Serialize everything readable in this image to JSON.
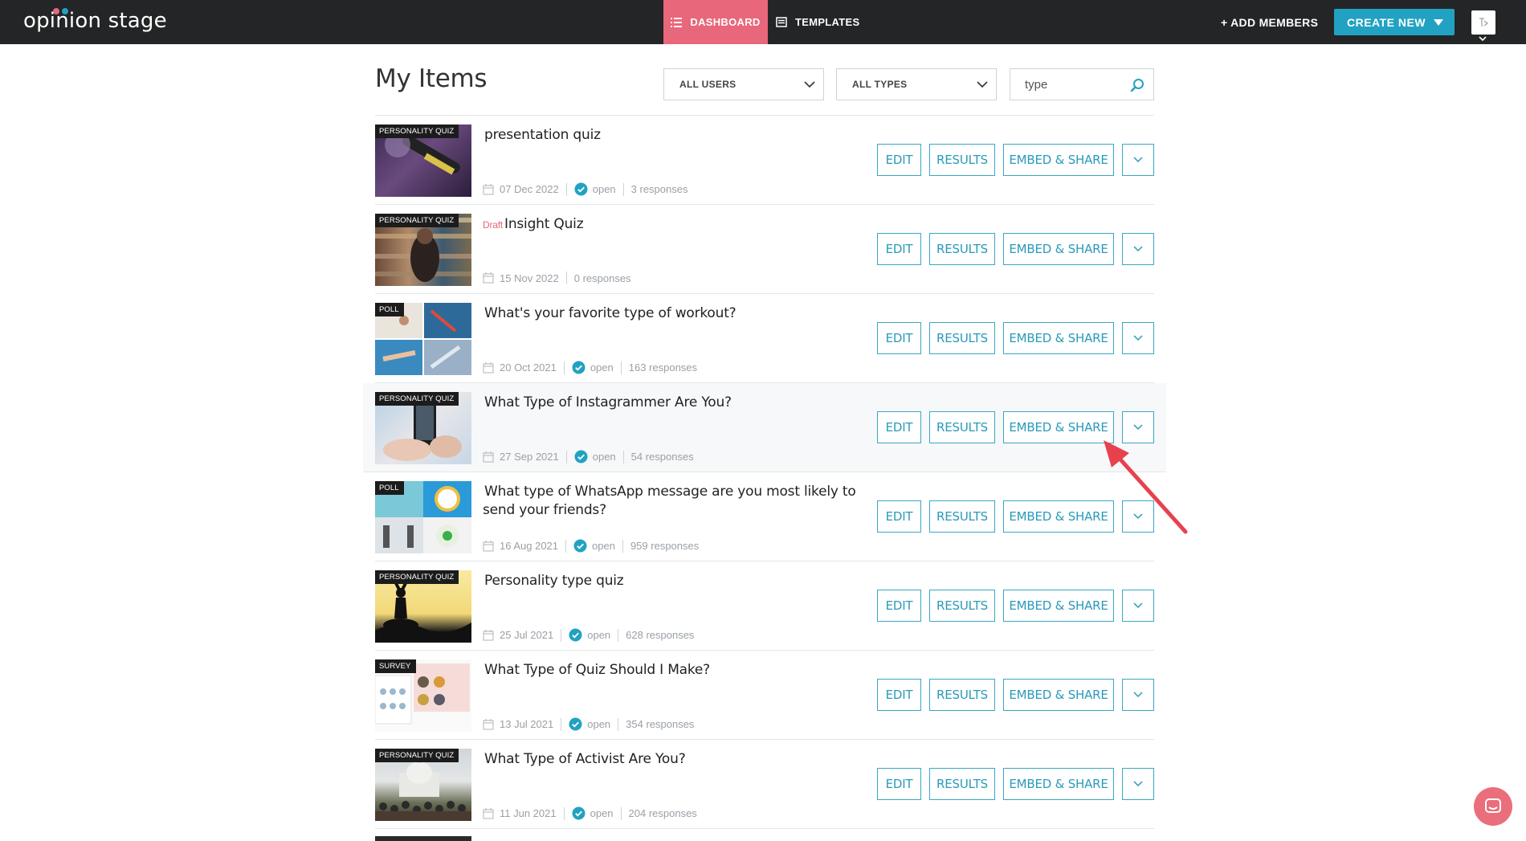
{
  "brand": {
    "logo_text": "opinion stage"
  },
  "nav": {
    "dashboard_label": "DASHBOARD",
    "templates_label": "TEMPLATES",
    "add_members_label": "+ ADD MEMBERS",
    "create_new_label": "CREATE NEW"
  },
  "header": {
    "title": "My Items",
    "users_filter": "ALL USERS",
    "types_filter": "ALL TYPES",
    "search_value": "type"
  },
  "buttons": {
    "edit": "EDIT",
    "results": "RESULTS",
    "embed_share": "EMBED & SHARE"
  },
  "items": [
    {
      "tag": "PERSONALITY QUIZ",
      "draft": "",
      "title": "presentation quiz",
      "date": "07 Dec 2022",
      "status": "open",
      "responses": "3 responses"
    },
    {
      "tag": "PERSONALITY QUIZ",
      "draft": "Draft",
      "title": "Insight Quiz",
      "date": "15 Nov 2022",
      "status": "",
      "responses": "0 responses"
    },
    {
      "tag": "POLL",
      "draft": "",
      "title": "What's your favorite type of workout?",
      "date": "20 Oct 2021",
      "status": "open",
      "responses": "163 responses"
    },
    {
      "tag": "PERSONALITY QUIZ",
      "draft": "",
      "title": "What Type of Instagrammer Are You?",
      "date": "27 Sep 2021",
      "status": "open",
      "responses": "54 responses"
    },
    {
      "tag": "POLL",
      "draft": "",
      "title": "What type of WhatsApp message are you most likely to send your friends?",
      "date": "16 Aug 2021",
      "status": "open",
      "responses": "959 responses"
    },
    {
      "tag": "PERSONALITY QUIZ",
      "draft": "",
      "title": "Personality type quiz",
      "date": "25 Jul 2021",
      "status": "open",
      "responses": "628 responses"
    },
    {
      "tag": "SURVEY",
      "draft": "",
      "title": "What Type of Quiz Should I Make?",
      "date": "13 Jul 2021",
      "status": "open",
      "responses": "354 responses"
    },
    {
      "tag": "PERSONALITY QUIZ",
      "draft": "",
      "title": "What Type of Activist Are You?",
      "date": "11 Jun 2021",
      "status": "open",
      "responses": "204 responses"
    }
  ],
  "colors": {
    "topbar": "#242526",
    "dashboard_active": "#e8677a",
    "create_new": "#22a2c2",
    "button_outline": "#3aa7c5",
    "draft": "#e8677a",
    "annotation_arrow": "#e8414e"
  },
  "icons": [
    "list-icon",
    "templates-icon",
    "chevron-down-icon",
    "search-icon",
    "calendar-icon",
    "check-circle-icon",
    "chat-icon"
  ]
}
